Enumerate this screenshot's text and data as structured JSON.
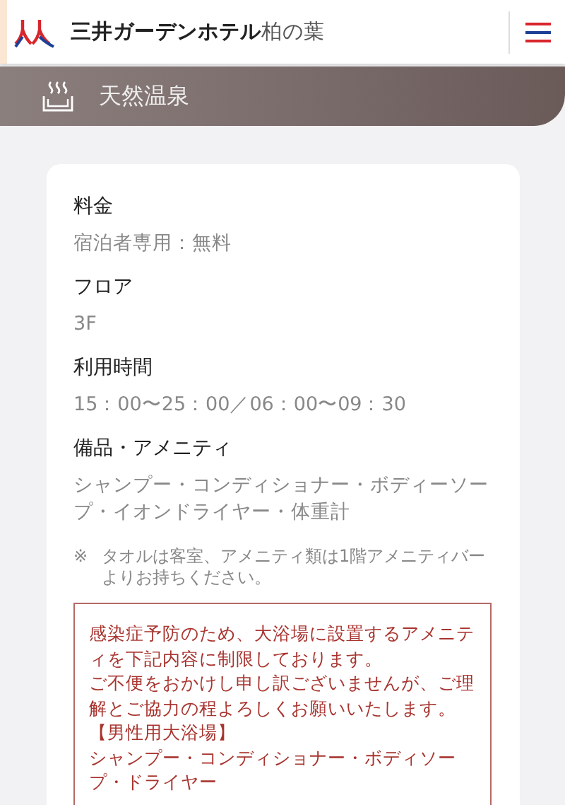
{
  "header": {
    "title": "三井ガーデンホテル",
    "title_suffix": "柏の葉"
  },
  "banner": {
    "title": "天然温泉"
  },
  "sections": [
    {
      "label": "料金",
      "value": "宿泊者専用：無料"
    },
    {
      "label": "フロア",
      "value": "3F"
    },
    {
      "label": "利用時間",
      "value": "15：00〜25：00／06：00〜09：30"
    },
    {
      "label": "備品・アメニティ",
      "value": "シャンプー・コンディショナー・ボディーソープ・イオンドライヤー・体重計",
      "note_mark": "※",
      "note": "タオルは客室、アメニティ類は1階アメニティバーよりお持ちください。"
    }
  ],
  "notice": {
    "lines": [
      "感染症予防のため、大浴場に設置するアメニティを下記内容に制限しております。",
      "ご不便をおかけし申し訳ございませんが、ご理解とご協力の程よろしくお願いいたします。",
      "【男性用大浴場】",
      "シャンプー・コンディショナー・ボディソープ・ドライヤー"
    ]
  }
}
